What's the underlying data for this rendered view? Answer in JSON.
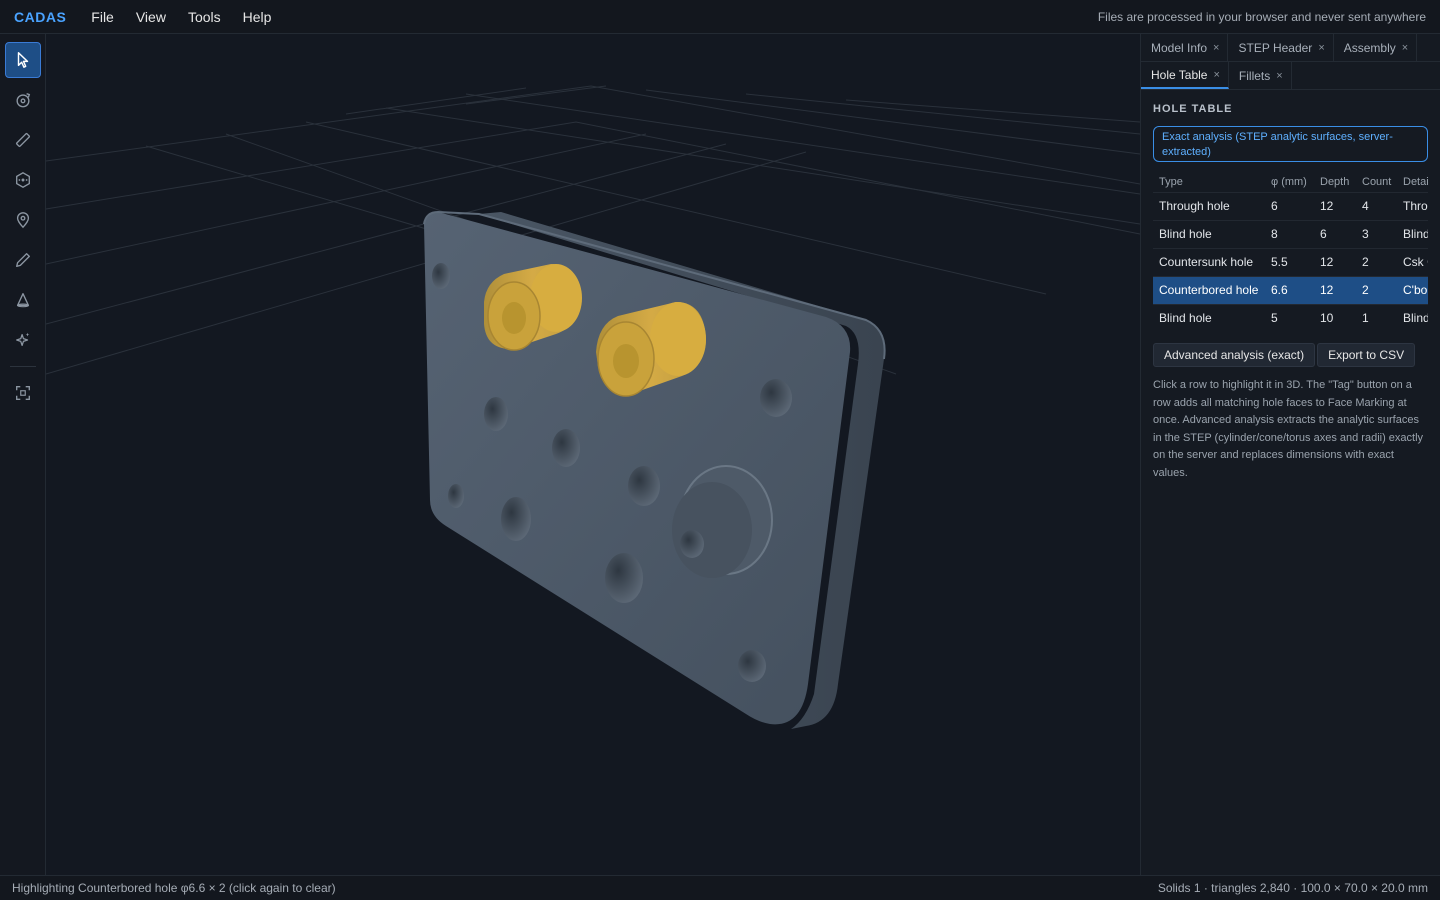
{
  "app": {
    "brand": "CADAS"
  },
  "menu": {
    "items": [
      "File",
      "View",
      "Tools",
      "Help"
    ]
  },
  "privacy_note": "Files are processed in your browser and never sent anywhere",
  "toolbar": {
    "tools": [
      {
        "name": "select",
        "icon": "cursor-arrow-icon",
        "active": true
      },
      {
        "name": "orbit",
        "icon": "orbit-icon",
        "active": false
      },
      {
        "name": "measure",
        "icon": "ruler-icon",
        "active": false
      },
      {
        "name": "features",
        "icon": "hexagon-node-icon",
        "active": false
      },
      {
        "name": "marker",
        "icon": "map-pin-icon",
        "active": false
      },
      {
        "name": "sketch",
        "icon": "pencil-icon",
        "active": false
      },
      {
        "name": "draft",
        "icon": "cone-icon",
        "active": false
      },
      {
        "name": "ai",
        "icon": "sparkles-icon",
        "active": false
      },
      {
        "name": "fit",
        "icon": "focus-frame-icon",
        "active": false
      }
    ]
  },
  "panel": {
    "tabs_row1": [
      {
        "label": "Model Info",
        "close": "×"
      },
      {
        "label": "STEP Header",
        "close": "×"
      },
      {
        "label": "Assembly",
        "close": "×"
      }
    ],
    "tabs_row2": [
      {
        "label": "Hole Table",
        "close": "×",
        "active": true
      },
      {
        "label": "Fillets",
        "close": "×"
      }
    ],
    "section_title": "HOLE TABLE",
    "exact_badge": "Exact analysis (STEP analytic surfaces, server-extracted)",
    "table": {
      "headers": [
        "Type",
        "φ (mm)",
        "Depth",
        "Count",
        "Detai"
      ],
      "rows": [
        {
          "type": "Through hole",
          "dia": "6",
          "depth": "12",
          "count": "4",
          "detail": "Thro"
        },
        {
          "type": "Blind hole",
          "dia": "8",
          "depth": "6",
          "count": "3",
          "detail": "Blind"
        },
        {
          "type": "Countersunk hole",
          "dia": "5.5",
          "depth": "12",
          "count": "2",
          "detail": "Csk ¢"
        },
        {
          "type": "Counterbored hole",
          "dia": "6.6",
          "depth": "12",
          "count": "2",
          "detail": "C'bo",
          "selected": true
        },
        {
          "type": "Blind hole",
          "dia": "5",
          "depth": "10",
          "count": "1",
          "detail": "Blind"
        }
      ]
    },
    "buttons": {
      "advanced": "Advanced analysis (exact)",
      "export": "Export to CSV"
    },
    "help_text": "Click a row to highlight it in 3D. The \"Tag\" button on a row adds all matching hole faces to Face Marking at once. Advanced analysis extracts the analytic surfaces in the STEP (cylinder/cone/torus axes and radii) exactly on the server and replaces dimensions with exact values."
  },
  "status": {
    "left": "Highlighting Counterbored hole φ6.6 × 2 (click again to clear)",
    "right": "Solids 1 · triangles 2,840 · 100.0 × 70.0 × 20.0 mm"
  },
  "colors": {
    "accent": "#3a8ee6",
    "highlight": "#e3b341",
    "part": "#4a5664",
    "selected_row": "#1e4e86"
  }
}
